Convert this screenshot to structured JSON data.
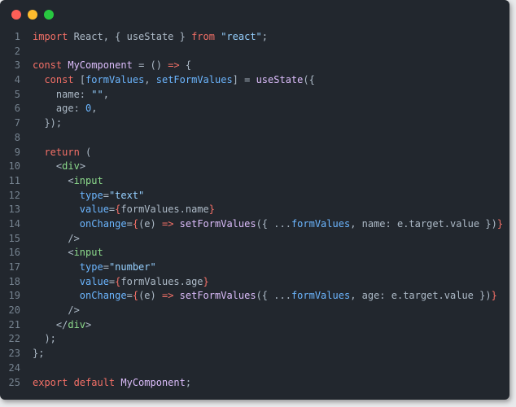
{
  "window": {
    "controls": {
      "close_color": "#fe5f57",
      "minimize_color": "#febc2e",
      "maximize_color": "#28c840"
    }
  },
  "code": {
    "language": "jsx",
    "lines": [
      {
        "n": "1",
        "tokens": [
          [
            "kw",
            "import "
          ],
          [
            "plain",
            "React, { useState } "
          ],
          [
            "kw",
            "from "
          ],
          [
            "str",
            "\"react\""
          ],
          [
            "plain",
            ";"
          ]
        ]
      },
      {
        "n": "2",
        "tokens": []
      },
      {
        "n": "3",
        "tokens": [
          [
            "kw",
            "const "
          ],
          [
            "fn",
            "MyComponent"
          ],
          [
            "plain",
            " = () "
          ],
          [
            "kw",
            "=>"
          ],
          [
            "plain",
            " {"
          ]
        ]
      },
      {
        "n": "4",
        "tokens": [
          [
            "plain",
            "  "
          ],
          [
            "kw",
            "const "
          ],
          [
            "plain",
            "["
          ],
          [
            "attr",
            "formValues"
          ],
          [
            "plain",
            ", "
          ],
          [
            "attr",
            "setFormValues"
          ],
          [
            "plain",
            "] = "
          ],
          [
            "fn",
            "useState"
          ],
          [
            "plain",
            "({"
          ]
        ]
      },
      {
        "n": "5",
        "tokens": [
          [
            "plain",
            "    name: "
          ],
          [
            "str",
            "\"\""
          ],
          [
            "plain",
            ","
          ]
        ]
      },
      {
        "n": "6",
        "tokens": [
          [
            "plain",
            "    age: "
          ],
          [
            "num",
            "0"
          ],
          [
            "plain",
            ","
          ]
        ]
      },
      {
        "n": "7",
        "tokens": [
          [
            "plain",
            "  });"
          ]
        ]
      },
      {
        "n": "8",
        "tokens": []
      },
      {
        "n": "9",
        "tokens": [
          [
            "plain",
            "  "
          ],
          [
            "kw",
            "return"
          ],
          [
            "plain",
            " ("
          ]
        ]
      },
      {
        "n": "10",
        "tokens": [
          [
            "plain",
            "    <"
          ],
          [
            "tag",
            "div"
          ],
          [
            "plain",
            ">"
          ]
        ]
      },
      {
        "n": "11",
        "tokens": [
          [
            "plain",
            "      <"
          ],
          [
            "tag",
            "input"
          ]
        ]
      },
      {
        "n": "12",
        "tokens": [
          [
            "plain",
            "        "
          ],
          [
            "attr",
            "type"
          ],
          [
            "plain",
            "="
          ],
          [
            "str",
            "\"text\""
          ]
        ]
      },
      {
        "n": "13",
        "tokens": [
          [
            "plain",
            "        "
          ],
          [
            "attr",
            "value"
          ],
          [
            "plain",
            "="
          ],
          [
            "kw",
            "{"
          ],
          [
            "plain",
            "formValues.name"
          ],
          [
            "kw",
            "}"
          ]
        ]
      },
      {
        "n": "14",
        "tokens": [
          [
            "plain",
            "        "
          ],
          [
            "attr",
            "onChange"
          ],
          [
            "plain",
            "="
          ],
          [
            "kw",
            "{"
          ],
          [
            "plain",
            "(e) "
          ],
          [
            "kw",
            "=>"
          ],
          [
            "plain",
            " "
          ],
          [
            "fn",
            "setFormValues"
          ],
          [
            "plain",
            "({ ..."
          ],
          [
            "attr",
            "formValues"
          ],
          [
            "plain",
            ", name: e.target.value })"
          ],
          [
            "kw",
            "}"
          ]
        ]
      },
      {
        "n": "15",
        "tokens": [
          [
            "plain",
            "      />"
          ]
        ]
      },
      {
        "n": "16",
        "tokens": [
          [
            "plain",
            "      <"
          ],
          [
            "tag",
            "input"
          ]
        ]
      },
      {
        "n": "17",
        "tokens": [
          [
            "plain",
            "        "
          ],
          [
            "attr",
            "type"
          ],
          [
            "plain",
            "="
          ],
          [
            "str",
            "\"number\""
          ]
        ]
      },
      {
        "n": "18",
        "tokens": [
          [
            "plain",
            "        "
          ],
          [
            "attr",
            "value"
          ],
          [
            "plain",
            "="
          ],
          [
            "kw",
            "{"
          ],
          [
            "plain",
            "formValues.age"
          ],
          [
            "kw",
            "}"
          ]
        ]
      },
      {
        "n": "19",
        "tokens": [
          [
            "plain",
            "        "
          ],
          [
            "attr",
            "onChange"
          ],
          [
            "plain",
            "="
          ],
          [
            "kw",
            "{"
          ],
          [
            "plain",
            "(e) "
          ],
          [
            "kw",
            "=>"
          ],
          [
            "plain",
            " "
          ],
          [
            "fn",
            "setFormValues"
          ],
          [
            "plain",
            "({ ..."
          ],
          [
            "attr",
            "formValues"
          ],
          [
            "plain",
            ", age: e.target.value })"
          ],
          [
            "kw",
            "}"
          ]
        ]
      },
      {
        "n": "20",
        "tokens": [
          [
            "plain",
            "      />"
          ]
        ]
      },
      {
        "n": "21",
        "tokens": [
          [
            "plain",
            "    </"
          ],
          [
            "tag",
            "div"
          ],
          [
            "plain",
            ">"
          ]
        ]
      },
      {
        "n": "22",
        "tokens": [
          [
            "plain",
            "  );"
          ]
        ]
      },
      {
        "n": "23",
        "tokens": [
          [
            "plain",
            "};"
          ]
        ]
      },
      {
        "n": "24",
        "tokens": []
      },
      {
        "n": "25",
        "tokens": [
          [
            "kw",
            "export "
          ],
          [
            "kw",
            "default "
          ],
          [
            "fn",
            "MyComponent"
          ],
          [
            "plain",
            ";"
          ]
        ]
      }
    ]
  }
}
